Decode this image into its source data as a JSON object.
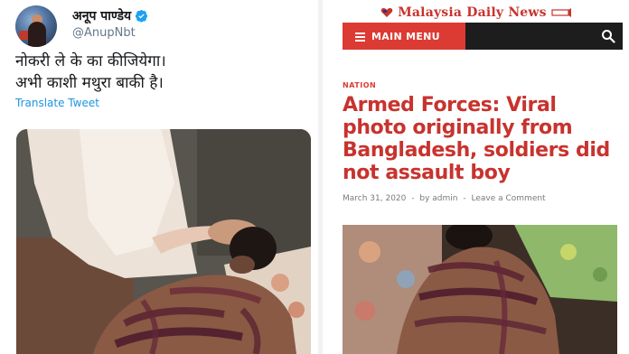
{
  "tweet": {
    "author_name": "अनूप पाण्डेय",
    "handle": "@AnupNbt",
    "text_lines": [
      "नोकरी ले के का कीजियेगा।",
      "अभी काशी मथुरा बाकी है।"
    ],
    "translate_label": "Translate Tweet",
    "avatar_icon": "user-avatar",
    "verified_icon": "verified-badge-icon",
    "accent_color": "#1b95e0"
  },
  "news": {
    "brand_title": "Malaysia Daily News",
    "menu_label": "MAIN MENU",
    "menu_icon": "hamburger-icon",
    "search_icon": "search-icon",
    "category": "NATION",
    "headline": "Armed Forces: Viral photo originally from Bangladesh, soldiers did not assault boy",
    "date": "March 31, 2020",
    "author": "by admin",
    "comment_link": "Leave a Comment",
    "meta_separator": "-",
    "accent_color": "#dc3b34",
    "headline_color": "#c8332e"
  }
}
